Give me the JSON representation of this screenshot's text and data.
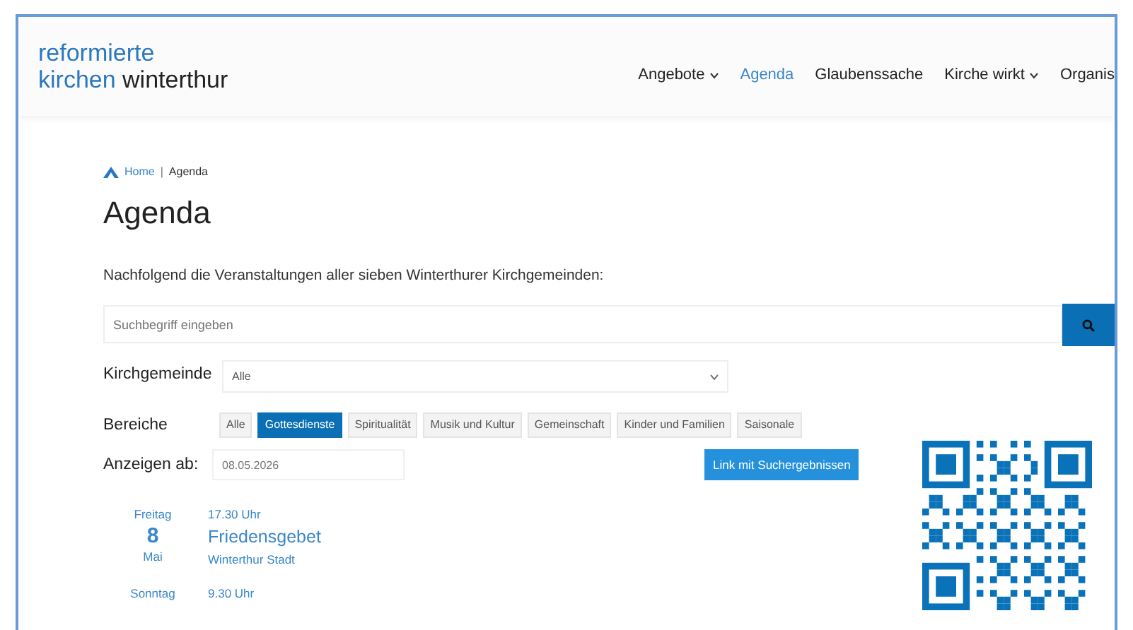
{
  "header": {
    "logo": {
      "line_1": "reformierte",
      "line_2_a": "kirchen",
      "line_2_b": "winterthur"
    },
    "nav": [
      {
        "label": "Angebote",
        "dropdown": true,
        "selected": false
      },
      {
        "label": "Agenda",
        "dropdown": false,
        "selected": true
      },
      {
        "label": "Glaubenssache",
        "dropdown": false,
        "selected": false
      },
      {
        "label": "Kirche wirkt",
        "dropdown": true,
        "selected": false
      },
      {
        "label": "Organis",
        "dropdown": false,
        "selected": false
      }
    ]
  },
  "breadcrumb": [
    {
      "label": "Home",
      "kind": "link"
    },
    {
      "label": "Agenda",
      "kind": "current"
    }
  ],
  "breadcrumb_separator": "|",
  "title": "Agenda",
  "intro": "Nachfolgend die Veranstaltungen aller sieben Winterthurer Kirchgemeinden:",
  "search": {
    "placeholder": "Suchbegriff eingeben"
  },
  "filters": {
    "parish_label": "Kirchgemeinde",
    "parish_value": "Alle",
    "areas_label": "Bereiche",
    "areas": [
      {
        "label": "Alle",
        "selected": false
      },
      {
        "label": "Gottesdienste",
        "selected": true
      },
      {
        "label": "Spiritualität",
        "selected": false
      },
      {
        "label": "Musik und Kultur",
        "selected": false
      },
      {
        "label": "Gemeinschaft",
        "selected": false
      },
      {
        "label": "Kinder und Familien",
        "selected": false
      },
      {
        "label": "Saisonale",
        "selected": false
      }
    ],
    "date_label": "Anzeigen ab:",
    "date_value": "08.05.2026",
    "link_button": "Link mit Suchergebnissen"
  },
  "events": [
    {
      "weekday": "Freitag",
      "day": "8",
      "month": "Mai",
      "time": "17.30 Uhr",
      "title": "Friedensgebet",
      "place": "Winterthur Stadt"
    },
    {
      "weekday": "Sonntag",
      "time": "9.30 Uhr"
    }
  ]
}
